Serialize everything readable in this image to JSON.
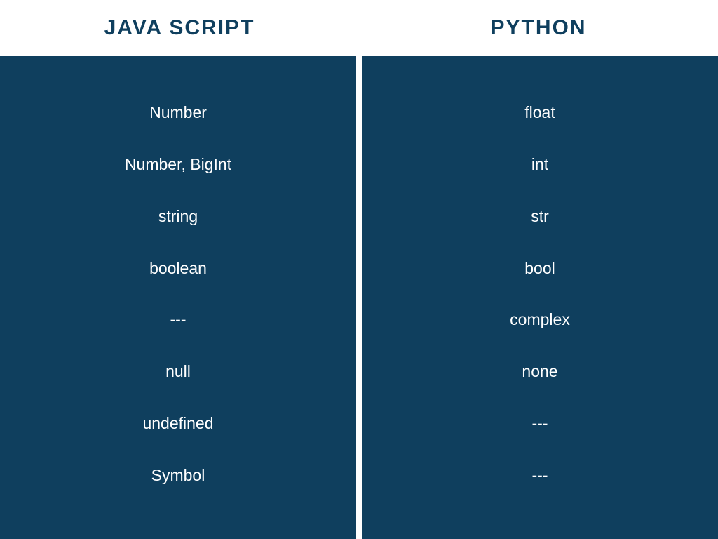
{
  "headers": {
    "left": "JAVA SCRIPT",
    "right": "PYTHON"
  },
  "rows": {
    "r0": {
      "left": "Number",
      "right": "float"
    },
    "r1": {
      "left": "Number, BigInt",
      "right": "int"
    },
    "r2": {
      "left": "string",
      "right": "str"
    },
    "r3": {
      "left": "boolean",
      "right": "bool"
    },
    "r4": {
      "left": "---",
      "right": "complex"
    },
    "r5": {
      "left": "null",
      "right": "none"
    },
    "r6": {
      "left": "undefined",
      "right": "---"
    },
    "r7": {
      "left": "Symbol",
      "right": "---"
    }
  },
  "chart_data": {
    "type": "table",
    "title": "",
    "columns": [
      "JAVA SCRIPT",
      "PYTHON"
    ],
    "rows": [
      [
        "Number",
        "float"
      ],
      [
        "Number, BigInt",
        "int"
      ],
      [
        "string",
        "str"
      ],
      [
        "boolean",
        "bool"
      ],
      [
        "---",
        "complex"
      ],
      [
        "null",
        "none"
      ],
      [
        "undefined",
        "---"
      ],
      [
        "Symbol",
        "---"
      ]
    ]
  }
}
